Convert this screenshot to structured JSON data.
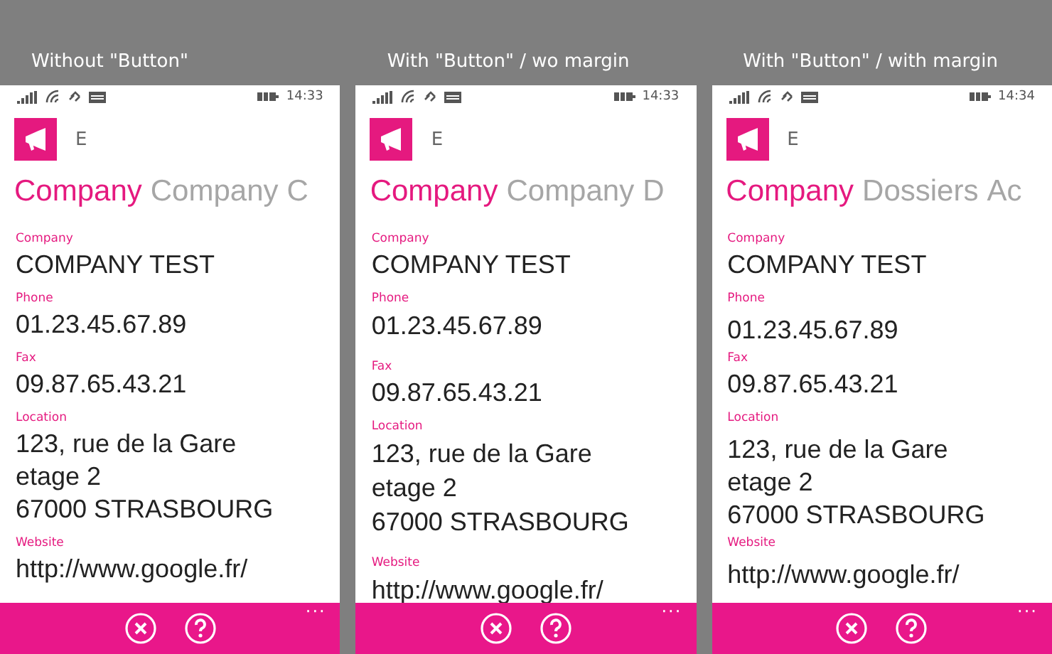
{
  "panels": [
    {
      "caption": "Without \"Button\"",
      "kind": "plain",
      "status_time": "14:33",
      "app_letter": "E",
      "pivots": [
        {
          "label": "Company",
          "selected": true
        },
        {
          "label": "Company",
          "selected": false
        },
        {
          "label": "C",
          "selected": false
        }
      ],
      "fields": [
        {
          "label": "Company",
          "kind": "text",
          "lines": [
            "COMPANY TEST"
          ]
        },
        {
          "label": "Phone",
          "kind": "text",
          "lines": [
            "01.23.45.67.89"
          ]
        },
        {
          "label": "Fax",
          "kind": "text",
          "lines": [
            "09.87.65.43.21"
          ]
        },
        {
          "label": "Location",
          "kind": "text",
          "lines": [
            "123, rue de la Gare",
            "etage 2",
            "67000 STRASBOURG"
          ]
        },
        {
          "label": "Website",
          "kind": "text",
          "lines": [
            "http://www.google.fr/"
          ]
        }
      ],
      "app_bar": {
        "buttons": [
          {
            "kind": "close"
          },
          {
            "kind": "help"
          }
        ],
        "more": "···"
      }
    },
    {
      "caption": "With \"Button\" / wo margin",
      "kind": "button",
      "status_time": "14:33",
      "app_letter": "E",
      "pivots": [
        {
          "label": "Company",
          "selected": true
        },
        {
          "label": "Company",
          "selected": false
        },
        {
          "label": "D",
          "selected": false
        }
      ],
      "fields": [
        {
          "label": "Company",
          "kind": "text",
          "lines": [
            "COMPANY TEST"
          ]
        },
        {
          "label": "Phone",
          "kind": "button",
          "lines": [
            "01.23.45.67.89"
          ]
        },
        {
          "label": "Fax",
          "kind": "text",
          "lines": [
            "09.87.65.43.21"
          ]
        },
        {
          "label": "Location",
          "kind": "button",
          "lines": [
            "123, rue de la Gare",
            "etage 2",
            "67000 STRASBOURG"
          ]
        },
        {
          "label": "Website",
          "kind": "button",
          "lines": [
            "http://www.google.fr/"
          ]
        }
      ],
      "app_bar": {
        "buttons": [
          {
            "kind": "close"
          },
          {
            "kind": "help"
          }
        ],
        "more": "···"
      }
    },
    {
      "caption": "With \"Button\" / with margin",
      "kind": "spaced",
      "status_time": "14:34",
      "app_letter": "E",
      "pivots": [
        {
          "label": "Company",
          "selected": true
        },
        {
          "label": "Dossiers",
          "selected": false
        },
        {
          "label": "Ac",
          "selected": false
        }
      ],
      "fields": [
        {
          "label": "Company",
          "kind": "text",
          "lines": [
            "COMPANY TEST"
          ]
        },
        {
          "label": "Phone",
          "kind": "button",
          "lines": [
            "01.23.45.67.89"
          ]
        },
        {
          "label": "Fax",
          "kind": "text",
          "lines": [
            "09.87.65.43.21"
          ]
        },
        {
          "label": "Location",
          "kind": "button",
          "lines": [
            "123, rue de la Gare",
            "etage 2",
            "67000 STRASBOURG"
          ]
        },
        {
          "label": "Website",
          "kind": "button",
          "lines": [
            "http://www.google.fr/"
          ]
        }
      ],
      "app_bar": {
        "buttons": [
          {
            "kind": "close"
          },
          {
            "kind": "help"
          }
        ],
        "more": "···"
      }
    }
  ]
}
